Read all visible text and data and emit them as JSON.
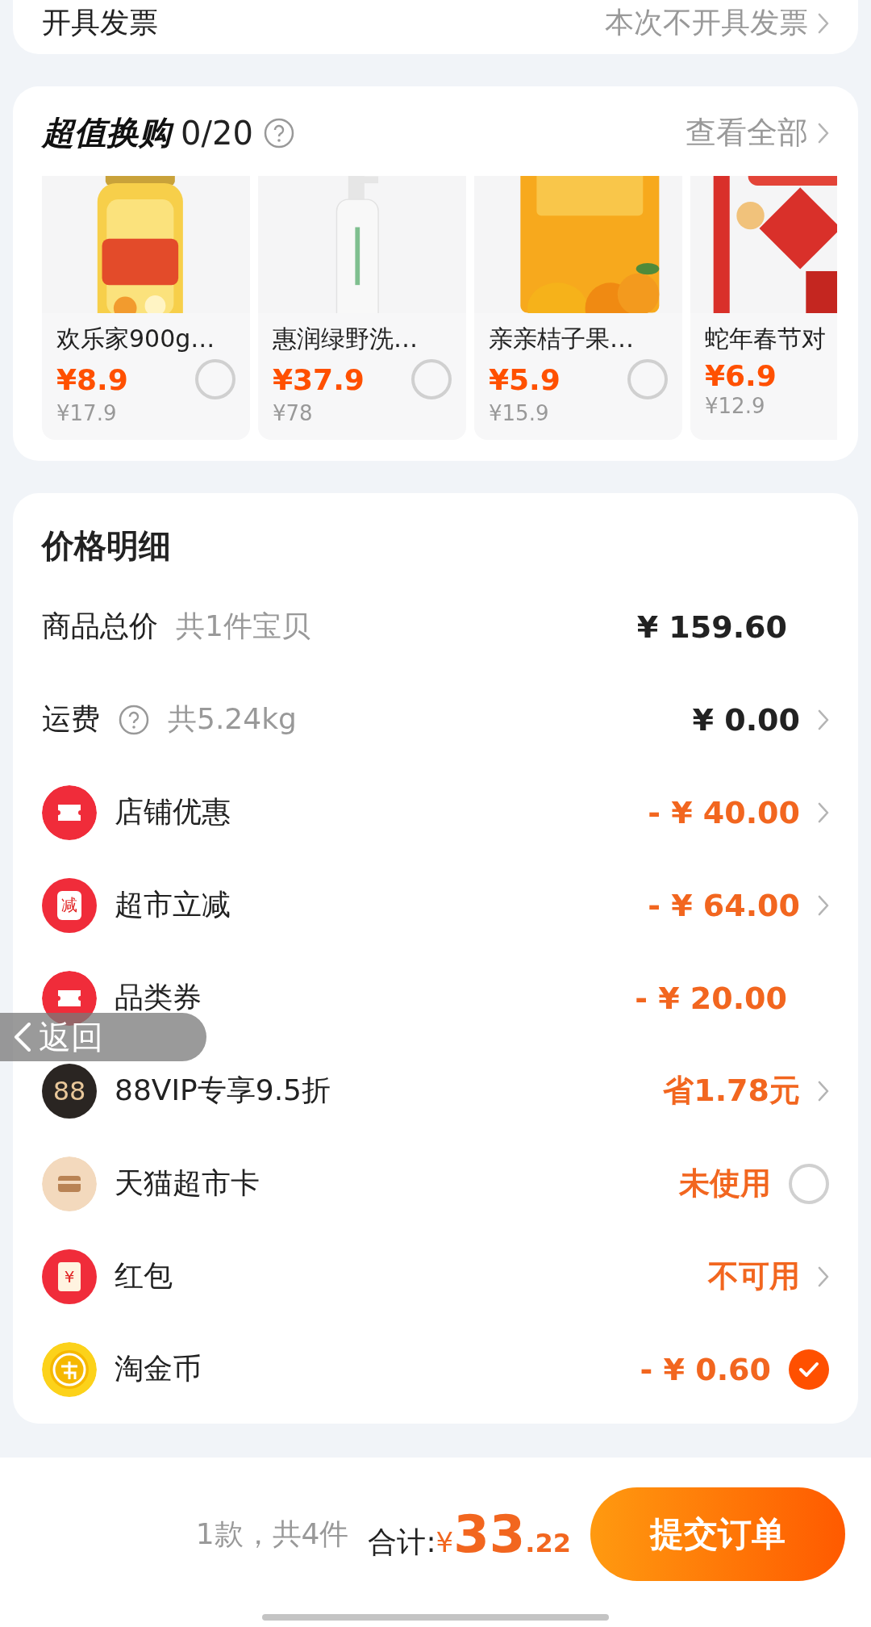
{
  "invoice": {
    "label": "开具发票",
    "value": "本次不开具发票"
  },
  "exchange": {
    "title": "超值换购",
    "count": "0/20",
    "view_all": "查看全部",
    "products": [
      {
        "name": "欢乐家900g…",
        "price": "¥8.9",
        "original_price": "¥17.9",
        "selected": false,
        "kind": "jar"
      },
      {
        "name": "惠润绿野洗…",
        "price": "¥37.9",
        "original_price": "¥78",
        "selected": false,
        "kind": "bottle"
      },
      {
        "name": "亲亲桔子果…",
        "price": "¥5.9",
        "original_price": "¥15.9",
        "selected": false,
        "kind": "jelly"
      },
      {
        "name": "蛇年春节对",
        "price": "¥6.9",
        "original_price": "¥12.9",
        "kind": "couplet"
      }
    ]
  },
  "price_details": {
    "title": "价格明细",
    "rows": [
      {
        "kind": "plain",
        "label": "商品总价",
        "note": "共1件宝贝",
        "value": "¥ 159.60",
        "accent": false,
        "chevron": false
      },
      {
        "kind": "shipping",
        "label": "运费",
        "note": "共5.24kg",
        "value": "¥ 0.00",
        "accent": false,
        "chevron": true
      },
      {
        "kind": "ticket",
        "label": "店铺优惠",
        "value": "- ¥ 40.00",
        "accent": true,
        "chevron": true
      },
      {
        "kind": "stamp",
        "icon_text": "减",
        "label": "超市立减",
        "value": "- ¥ 64.00",
        "accent": true,
        "chevron": true
      },
      {
        "kind": "ticket",
        "label": "品类券",
        "value": "- ¥ 20.00",
        "accent": true,
        "chevron": false
      },
      {
        "kind": "vip",
        "icon_text": "88",
        "label": "88VIP专享9.5折",
        "value": "省1.78元",
        "accent": true,
        "chevron": true
      },
      {
        "kind": "card",
        "label": "天猫超市卡",
        "value": "未使用",
        "accent": true,
        "chevron": false,
        "checked": false
      },
      {
        "kind": "envelope",
        "icon_text": "¥",
        "label": "红包",
        "value": "不可用",
        "accent": true,
        "chevron": true
      },
      {
        "kind": "coin",
        "label": "淘金币",
        "value": "- ¥ 0.60",
        "accent": true,
        "chevron": false,
        "checked": true
      }
    ]
  },
  "back_button": {
    "label": "返回"
  },
  "footer": {
    "summary": "1款，共4件",
    "total_label": "合计:",
    "currency": "¥",
    "total_int": "33",
    "total_dec": ".22",
    "submit": "提交订单"
  }
}
